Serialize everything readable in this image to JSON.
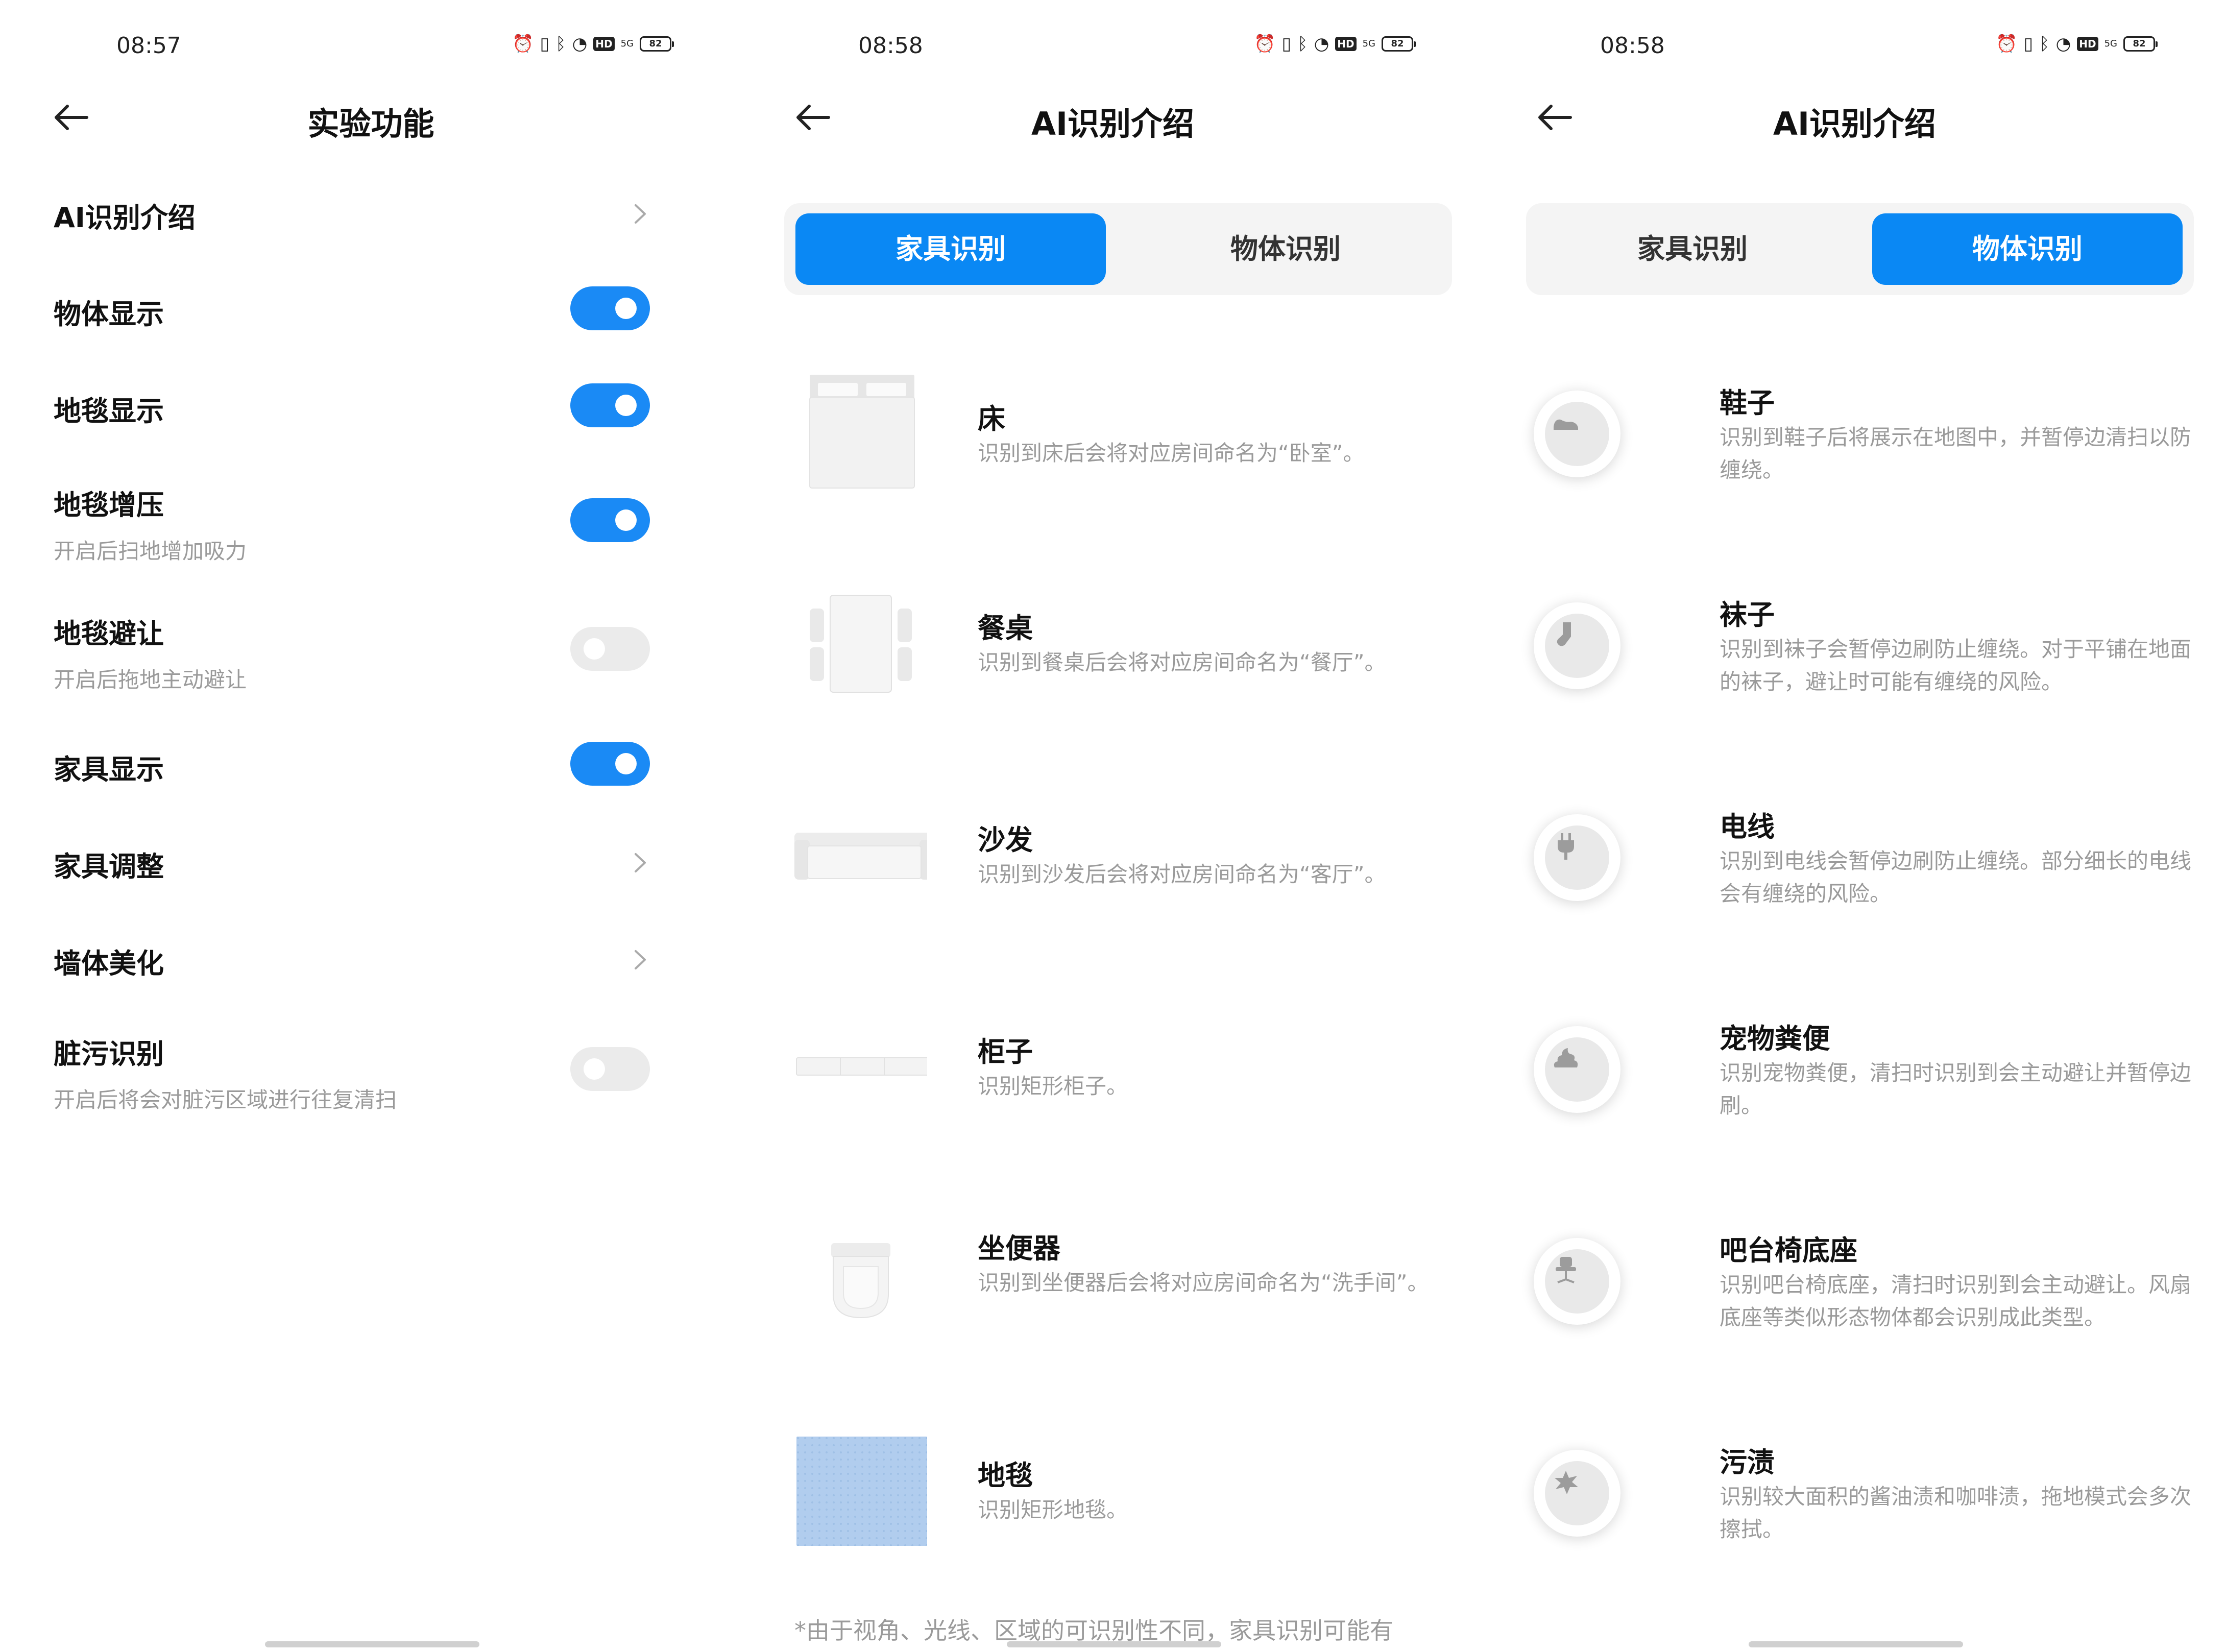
{
  "screens": [
    {
      "status": {
        "time": "08:57",
        "battery": "82",
        "network": "5G",
        "hd": "HD"
      },
      "title": "实验功能",
      "rows": [
        {
          "label": "AI识别介绍",
          "control": "chevron"
        },
        {
          "label": "物体显示",
          "control": "toggle",
          "on": true
        },
        {
          "label": "地毯显示",
          "control": "toggle",
          "on": true
        },
        {
          "label": "地毯增压",
          "sub": "开启后扫地增加吸力",
          "control": "toggle",
          "on": true
        },
        {
          "label": "地毯避让",
          "sub": "开启后拖地主动避让",
          "control": "toggle",
          "on": false
        },
        {
          "label": "家具显示",
          "control": "toggle",
          "on": true
        },
        {
          "label": "家具调整",
          "control": "chevron"
        },
        {
          "label": "墙体美化",
          "control": "chevron"
        },
        {
          "label": "脏污识别",
          "sub": "开启后将会对脏污区域进行往复清扫",
          "control": "toggle",
          "on": false
        }
      ]
    },
    {
      "status": {
        "time": "08:58",
        "battery": "82",
        "network": "5G",
        "hd": "HD"
      },
      "title": "AI识别介绍",
      "tabs": [
        {
          "label": "家具识别",
          "active": true
        },
        {
          "label": "物体识别",
          "active": false
        }
      ],
      "items": [
        {
          "icon": "bed-icon",
          "name": "床",
          "desc": "识别到床后会将对应房间命名为“卧室”。"
        },
        {
          "icon": "dining-table-icon",
          "name": "餐桌",
          "desc": "识别到餐桌后会将对应房间命名为“餐厅”。"
        },
        {
          "icon": "sofa-icon",
          "name": "沙发",
          "desc": "识别到沙发后会将对应房间命名为“客厅”。"
        },
        {
          "icon": "cabinet-icon",
          "name": "柜子",
          "desc": "识别矩形柜子。"
        },
        {
          "icon": "toilet-icon",
          "name": "坐便器",
          "desc": "识别到坐便器后会将对应房间命名为“洗手间”。"
        },
        {
          "icon": "carpet-icon",
          "name": "地毯",
          "desc": "识别矩形地毯。"
        }
      ],
      "footnote": "*由于视角、光线、区域的可识别性不同，家具识别可能有"
    },
    {
      "status": {
        "time": "08:58",
        "battery": "82",
        "network": "5G",
        "hd": "HD"
      },
      "title": "AI识别介绍",
      "tabs": [
        {
          "label": "家具识别",
          "active": false
        },
        {
          "label": "物体识别",
          "active": true
        }
      ],
      "items": [
        {
          "icon": "shoe-icon",
          "name": "鞋子",
          "desc": "识别到鞋子后将展示在地图中，并暂停边清扫以防缠绕。"
        },
        {
          "icon": "sock-icon",
          "name": "袜子",
          "desc": "识别到袜子会暂停边刷防止缠绕。对于平铺在地面的袜子，避让时可能有缠绕的风险。"
        },
        {
          "icon": "plug-icon",
          "name": "电线",
          "desc": "识别到电线会暂停边刷防止缠绕。部分细长的电线会有缠绕的风险。"
        },
        {
          "icon": "pet-waste-icon",
          "name": "宠物粪便",
          "desc": "识别宠物粪便，清扫时识别到会主动避让并暂停边刷。"
        },
        {
          "icon": "bar-chair-icon",
          "name": "吧台椅底座",
          "desc": "识别吧台椅底座，清扫时识别到会主动避让。风扇底座等类似形态物体都会识别成此类型。"
        },
        {
          "icon": "stain-icon",
          "name": "污渍",
          "desc": "识别较大面积的酱油渍和咖啡渍，拖地模式会多次擦拭。"
        }
      ]
    }
  ]
}
